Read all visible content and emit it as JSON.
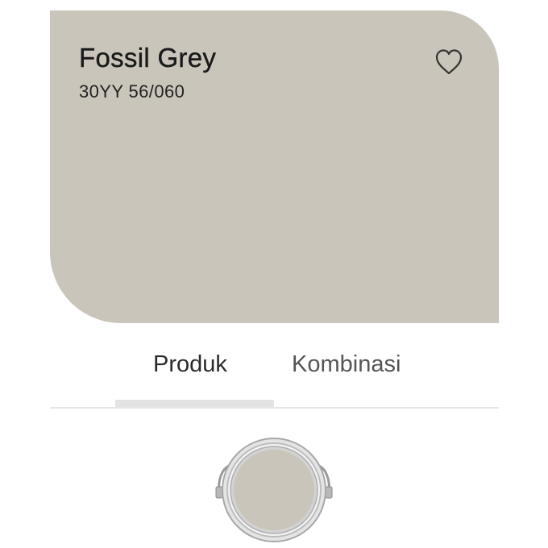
{
  "swatch": {
    "name": "Fossil Grey",
    "code": "30YY 56/060",
    "color": "#cac5ba"
  },
  "favorite": {
    "icon": "heart-outline-icon"
  },
  "tabs": [
    {
      "label": "Produk",
      "active": true
    },
    {
      "label": "Kombinasi",
      "active": false
    }
  ],
  "product": {
    "icon": "paint-can-icon",
    "paint_color": "#cac5ba"
  }
}
